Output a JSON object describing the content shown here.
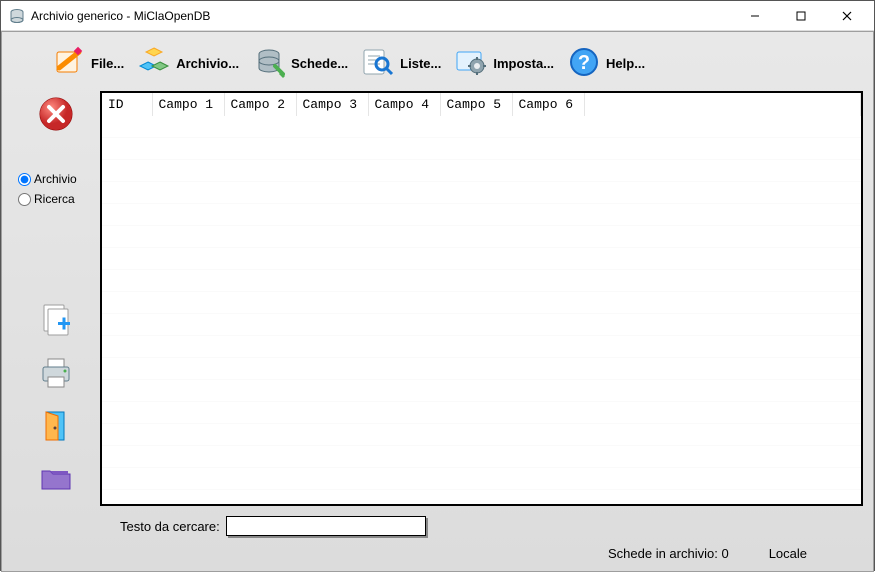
{
  "window": {
    "title": "Archivio generico - MiClaOpenDB"
  },
  "toolbar": {
    "file": "File...",
    "archivio": "Archivio...",
    "schede": "Schede...",
    "liste": "Liste...",
    "imposta": "Imposta...",
    "help": "Help..."
  },
  "leftRail": {
    "radioArchivio": "Archivio",
    "radioRicerca": "Ricerca"
  },
  "grid": {
    "columns": [
      "ID",
      "Campo 1",
      "Campo 2",
      "Campo 3",
      "Campo 4",
      "Campo 5",
      "Campo 6"
    ]
  },
  "search": {
    "label": "Testo da cercare:",
    "value": ""
  },
  "status": {
    "countLabel": "Schede in archivio: 0",
    "mode": "Locale"
  }
}
